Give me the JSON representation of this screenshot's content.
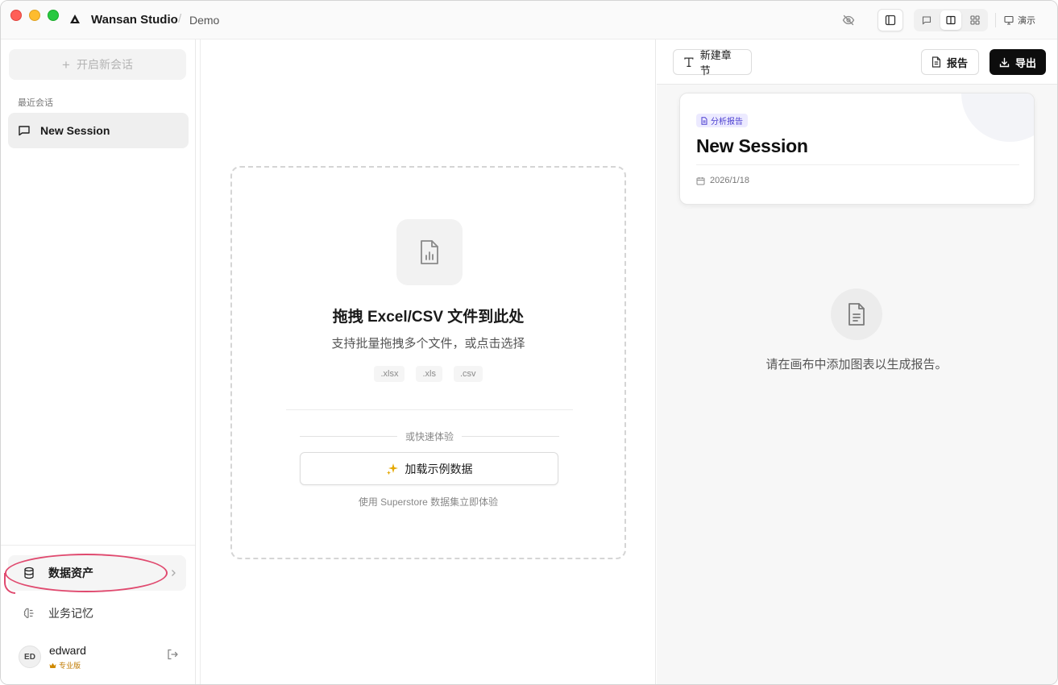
{
  "titlebar": {
    "app_name": "Wansan Studio",
    "separator": "/",
    "project": "Demo",
    "present_label": "演示"
  },
  "sidebar": {
    "new_chat_label": "开启新会话",
    "recent_label": "最近会话",
    "sessions": [
      {
        "label": "New Session"
      }
    ],
    "nav": {
      "assets_label": "数据资产",
      "memory_label": "业务记忆"
    },
    "user": {
      "initials": "ED",
      "name": "edward",
      "plan": "专业版"
    }
  },
  "canvas": {
    "dropzone_title": "拖拽 Excel/CSV 文件到此处",
    "dropzone_subtitle": "支持批量拖拽多个文件，或点击选择",
    "extensions": [
      ".xlsx",
      ".xls",
      ".csv"
    ],
    "or_label": "或快速体验",
    "sample_button_label": "加载示例数据",
    "sample_note": "使用 Superstore 数据集立即体验"
  },
  "report": {
    "new_section_label": "新建章节",
    "report_label": "报告",
    "export_label": "导出",
    "card": {
      "badge": "分析报告",
      "title": "New Session",
      "date": "2026/1/18"
    },
    "empty_message": "请在画布中添加图表以生成报告。"
  },
  "colors": {
    "accent_highlight": "#e04a6f",
    "badge_text": "#4b3fd0",
    "badge_bg": "#eceaff",
    "export_button": "#0d0d0d",
    "plan_gold": "#c07a00"
  }
}
